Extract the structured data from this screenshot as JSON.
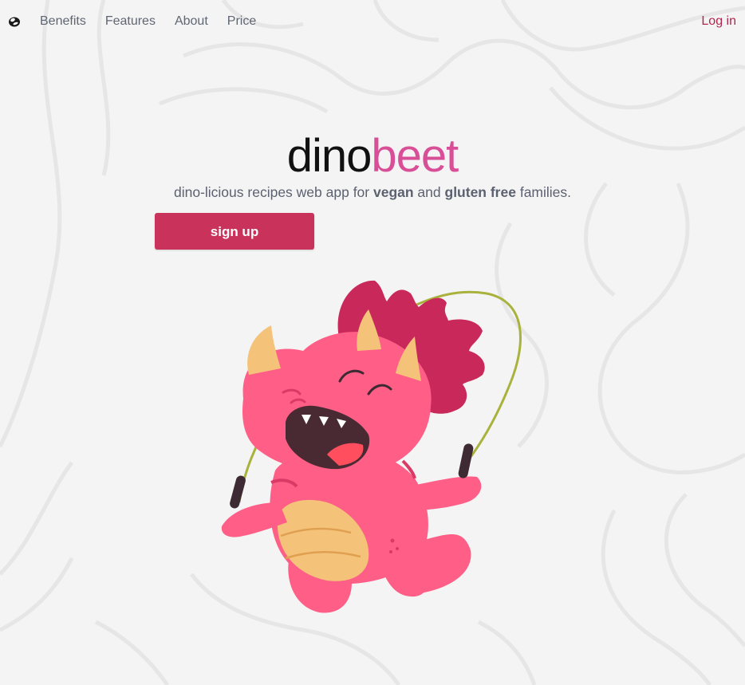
{
  "nav": {
    "links": [
      {
        "label": "Benefits"
      },
      {
        "label": "Features"
      },
      {
        "label": "About"
      },
      {
        "label": "Price"
      }
    ],
    "login_label": "Log in",
    "logo_icon": "egg-logo-icon"
  },
  "hero": {
    "brand_part1": "dino",
    "brand_part2": "beet",
    "tagline_pre": "dino-licious recipes web app for ",
    "tagline_bold1": "vegan",
    "tagline_mid": " and ",
    "tagline_bold2": "gluten free",
    "tagline_post": " families.",
    "signup_label": "sign up",
    "illustration": "jump-rope-dinosaur-illustration"
  },
  "colors": {
    "background": "#f4f4f4",
    "brand_dark": "#111111",
    "brand_pink": "#d94f97",
    "button": "#c9325a",
    "login": "#b2254d",
    "text_muted": "#5f6673"
  }
}
